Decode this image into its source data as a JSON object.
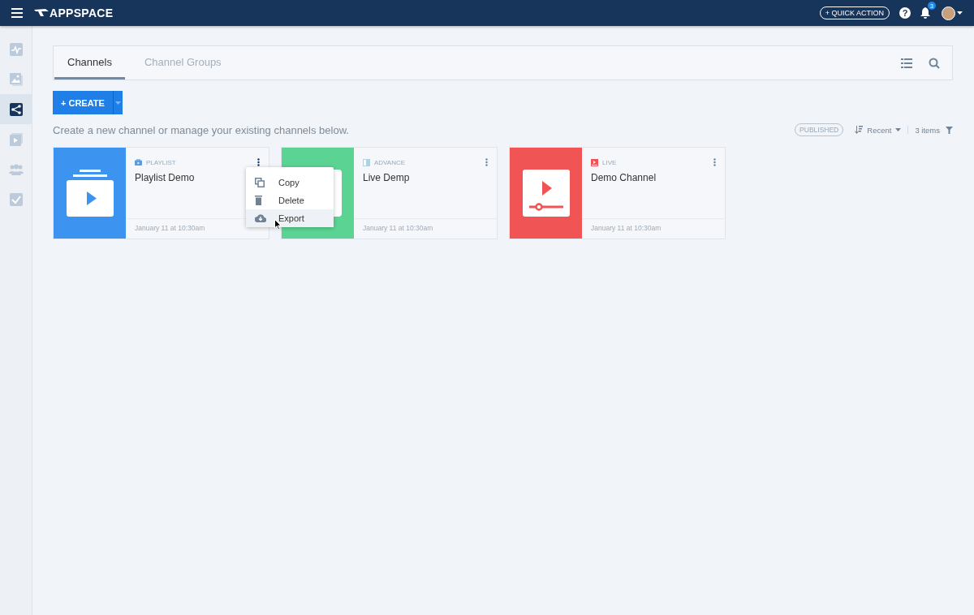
{
  "topbar": {
    "logo": "APPSPACE",
    "quick_action": "+ QUICK ACTION",
    "help": "?",
    "notifications": "3"
  },
  "sidebar": {
    "items": [
      {
        "kind": "dashboard",
        "selected": false
      },
      {
        "kind": "media",
        "selected": false
      },
      {
        "kind": "channels",
        "selected": true
      },
      {
        "kind": "playlists",
        "selected": false
      },
      {
        "kind": "users",
        "selected": false
      },
      {
        "kind": "tasks",
        "selected": false
      }
    ]
  },
  "tabs": [
    {
      "label": "Channels",
      "selected": true
    },
    {
      "label": "Channel Groups",
      "selected": false
    }
  ],
  "create_button": "+ CREATE",
  "description": "Create a new channel or manage your existing channels below.",
  "filter": {
    "status": "PUBLISHED",
    "sort": "Recent",
    "count": "3 items"
  },
  "channels": [
    {
      "kind": "playlist",
      "type_label": "PLAYLIST",
      "name": "Playlist Demo",
      "date": "January 11 at 10:30am",
      "color": "#3d94f0",
      "menu_open": true
    },
    {
      "kind": "advance",
      "type_label": "ADVANCE",
      "name": "Live Demp",
      "date": "January 11 at 10:30am",
      "color": "#5bd393",
      "menu_open": false
    },
    {
      "kind": "live",
      "type_label": "LIVE",
      "name": "Demo Channel",
      "date": "January 11 at 10:30am",
      "color": "#f05454",
      "menu_open": false
    }
  ],
  "context_menu": {
    "items": [
      {
        "kind": "copy",
        "label": "Copy",
        "highlighted": false
      },
      {
        "kind": "delete",
        "label": "Delete",
        "highlighted": false
      },
      {
        "kind": "export",
        "label": "Export",
        "highlighted": true
      }
    ]
  }
}
